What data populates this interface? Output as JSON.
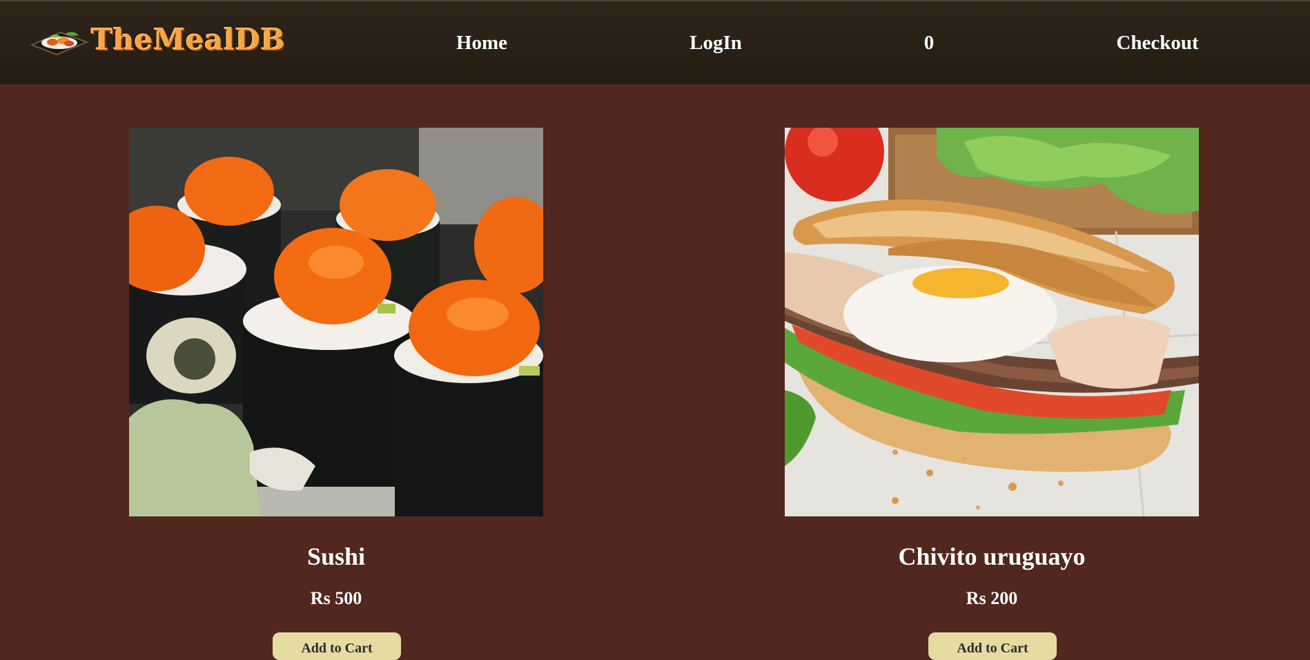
{
  "header": {
    "logo_text": "TheMealDB",
    "nav": {
      "home": "Home",
      "login": "LogIn",
      "cart_count": "0",
      "checkout": "Checkout"
    }
  },
  "meals": [
    {
      "name": "Sushi",
      "price": "Rs 500",
      "button_label": "Add to Cart",
      "image": "sushi-image"
    },
    {
      "name": "Chivito uruguayo",
      "price": "Rs 200",
      "button_label": "Add to Cart",
      "image": "chivito-sandwich-image"
    }
  ],
  "colors": {
    "background": "#51271f",
    "header": "#2a2117",
    "logo": "#f7a544",
    "button": "#e6dca2",
    "text": "#ffffff"
  }
}
